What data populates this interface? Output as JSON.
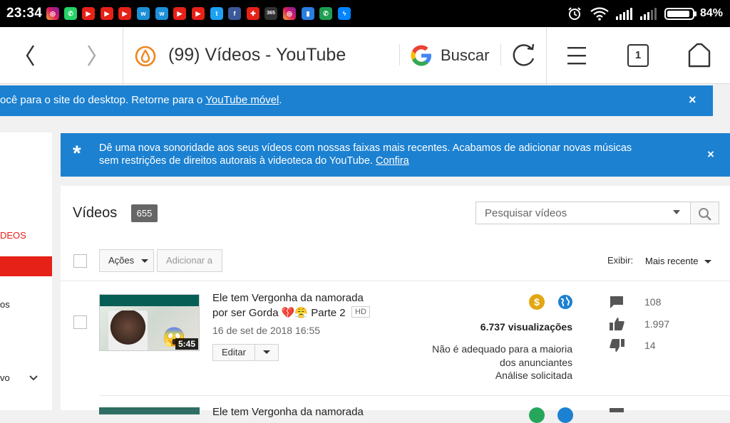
{
  "status_bar": {
    "time": "23:34",
    "battery": "84%",
    "notification_icons": [
      "instagram-icon",
      "whatsapp-icon",
      "youtube-icon",
      "youtube-icon",
      "youtube-icon",
      "wattpad-icon",
      "wattpad-icon",
      "youtube-icon",
      "youtube-icon",
      "twitter-icon",
      "facebook-icon",
      "toolbox-icon",
      "365-icon",
      "instagram-icon",
      "files-icon",
      "phone-icon",
      "messenger-icon"
    ],
    "notif_365_label": "365",
    "system_icons": [
      "alarm-icon",
      "wifi-icon",
      "signal-icon",
      "signal-icon",
      "battery-icon"
    ]
  },
  "browser": {
    "page_title": "(99) Vídeos - YouTube",
    "search_label": "Buscar",
    "tabs_count": "1"
  },
  "desktop_banner": {
    "text": "ocê para o site do desktop. Retorne para o ",
    "link": "YouTube móvel",
    "suffix": ".",
    "close": "×"
  },
  "audio_banner": {
    "line1": "Dê uma nova sonoridade aos seus vídeos com nossas faixas mais recentes. Acabamos de adicionar novas músicas",
    "line2": "sem restrições de direitos autorais à videoteca do YouTube. ",
    "link": "Confira",
    "star": "*",
    "close": "×"
  },
  "sidebar": {
    "item_active_label": "DEOS",
    "item_2_label": "os",
    "item_3_label": "vo"
  },
  "videos_panel": {
    "title": "Vídeos",
    "count": "655",
    "search_placeholder": "Pesquisar vídeos",
    "actions_label": "Ações",
    "add_to_label": "Adicionar a",
    "sort_label": "Exibir:",
    "sort_value": "Mais recente"
  },
  "video": {
    "title_line1": "Ele tem Vergonha da namorada",
    "title_line2": "por ser Gorda 💔😤 Parte 2",
    "hd": "HD",
    "date": "16 de set de 2018 16:55",
    "duration": "5:45",
    "edit_label": "Editar",
    "views": "6.737 visualizações",
    "ad_note_1": "Não é adequado para a maioria",
    "ad_note_2": "dos anunciantes",
    "ad_note_3": "Análise solicitada",
    "comments": "108",
    "likes": "1.997",
    "dislikes": "14",
    "next_title_partial": "Ele tem Vergonha da namorada"
  },
  "colors": {
    "banner_blue": "#1c81d1",
    "youtube_red": "#e62117",
    "monetization_gold": "#e2a712",
    "globe_blue": "#1c81d1"
  }
}
